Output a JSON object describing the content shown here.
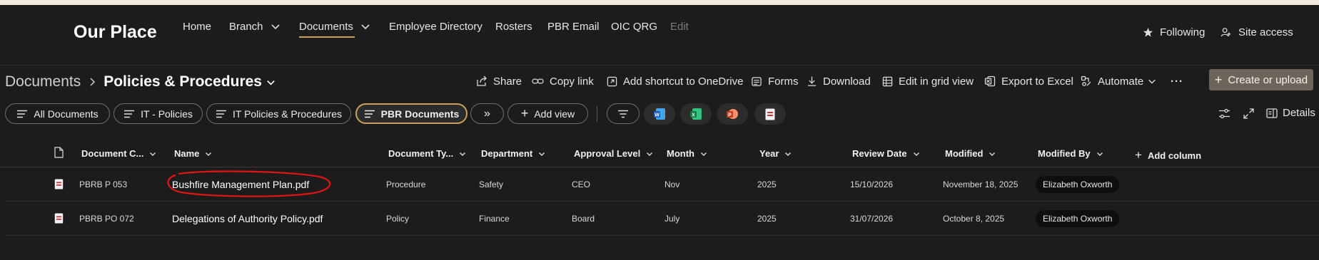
{
  "site": {
    "title": "Our Place",
    "nav": [
      "Home",
      "Branch",
      "Documents",
      "Employee Directory",
      "Rosters",
      "PBR Email",
      "OIC QRG",
      "Edit"
    ],
    "following": "Following",
    "site_access": "Site access"
  },
  "breadcrumb": {
    "root": "Documents",
    "current": "Policies & Procedures"
  },
  "commands": {
    "share": "Share",
    "copy_link": "Copy link",
    "add_shortcut": "Add shortcut to OneDrive",
    "forms": "Forms",
    "download": "Download",
    "edit_grid": "Edit in grid view",
    "export_excel": "Export to Excel",
    "automate": "Automate",
    "more": "···",
    "create": "Create or upload"
  },
  "views": {
    "pills": [
      "All Documents",
      "IT - Policies",
      "IT Policies & Procedures",
      "PBR Documents"
    ],
    "more": "»",
    "add_view": "Add view",
    "active": "PBR Documents"
  },
  "view_tools": {
    "details": "Details"
  },
  "columns": [
    "Document C...",
    "Name",
    "Document Ty...",
    "Department",
    "Approval Level",
    "Month",
    "Year",
    "Review Date",
    "Modified",
    "Modified By",
    "Add column"
  ],
  "rows": [
    {
      "code": "PBRB P 053",
      "name": "Bushfire Management Plan.pdf",
      "type": "Procedure",
      "department": "Safety",
      "approval": "CEO",
      "month": "Nov",
      "year": "2025",
      "review": "15/10/2026",
      "modified": "November 18, 2025",
      "modified_by": "Elizabeth Oxworth"
    },
    {
      "code": "PBRB PO 072",
      "name": "Delegations of Authority Policy.pdf",
      "type": "Policy",
      "department": "Finance",
      "approval": "Board",
      "month": "July",
      "year": "2025",
      "review": "31/07/2026",
      "modified": "October 8, 2025",
      "modified_by": "Elizabeth Oxworth"
    }
  ],
  "colors": {
    "accent": "#c9a15c",
    "background": "#1c1c1c",
    "annotation": "#e01515"
  }
}
